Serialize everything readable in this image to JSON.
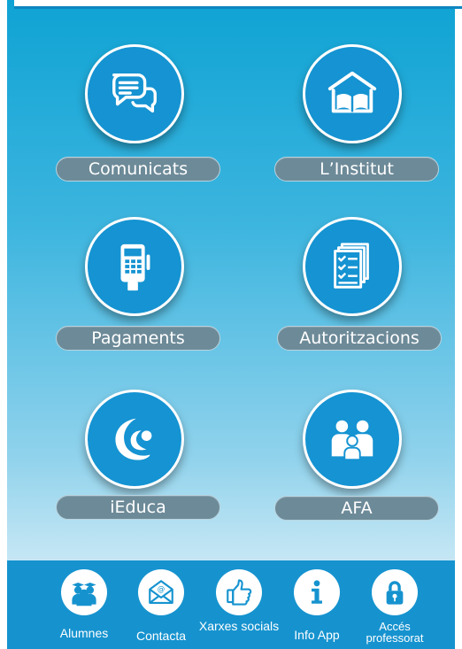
{
  "tiles": [
    {
      "label": "Comunicats",
      "icon": "chat-bubbles-icon"
    },
    {
      "label": "L’Institut",
      "icon": "school-book-icon"
    },
    {
      "label": "Pagaments",
      "icon": "card-terminal-icon"
    },
    {
      "label": "Autoritzacions",
      "icon": "checklist-documents-icon"
    },
    {
      "label": "iEduca",
      "icon": "ieduca-logo-icon"
    },
    {
      "label": "AFA",
      "icon": "family-icon"
    }
  ],
  "bottom_nav": [
    {
      "label": "Alumnes",
      "icon": "students-icon"
    },
    {
      "label": "Contacta",
      "icon": "mail-icon"
    },
    {
      "label": "Xarxes socials",
      "icon": "thumbs-up-icon"
    },
    {
      "label": "Info App",
      "icon": "info-icon"
    },
    {
      "label": "Accés professorat",
      "icon": "lock-icon"
    }
  ],
  "colors": {
    "accent": "#1593d2",
    "pill": "#6d8a98",
    "bar": "#1693cf"
  }
}
